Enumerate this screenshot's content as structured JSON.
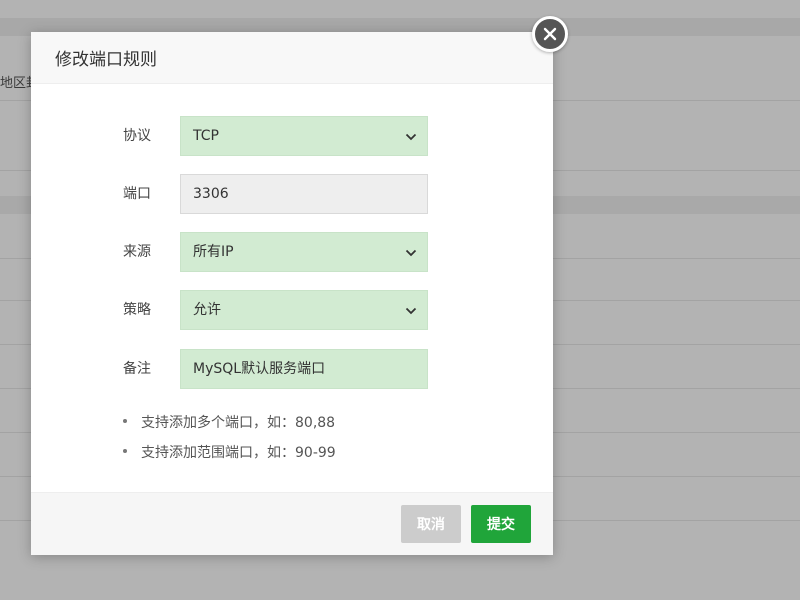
{
  "background": {
    "partial_text": "地区封"
  },
  "modal": {
    "title": "修改端口规则",
    "fields": {
      "protocol": {
        "label": "协议",
        "value": "TCP"
      },
      "port": {
        "label": "端口",
        "value": "3306"
      },
      "source": {
        "label": "来源",
        "value": "所有IP"
      },
      "policy": {
        "label": "策略",
        "value": "允许"
      },
      "remark": {
        "label": "备注",
        "value": "MySQL默认服务端口"
      }
    },
    "tips": [
      "支持添加多个端口，如：80,88",
      "支持添加范围端口，如：90-99"
    ],
    "buttons": {
      "cancel": "取消",
      "submit": "提交"
    }
  },
  "colors": {
    "accent": "#20a53a",
    "field_bg": "#d2ebd2",
    "readonly_bg": "#eeeeee",
    "cancel_bg": "#cccccc",
    "close_bg": "#555555"
  },
  "icons": {
    "close": "close-icon",
    "dropdown": "chevron-down-icon"
  }
}
